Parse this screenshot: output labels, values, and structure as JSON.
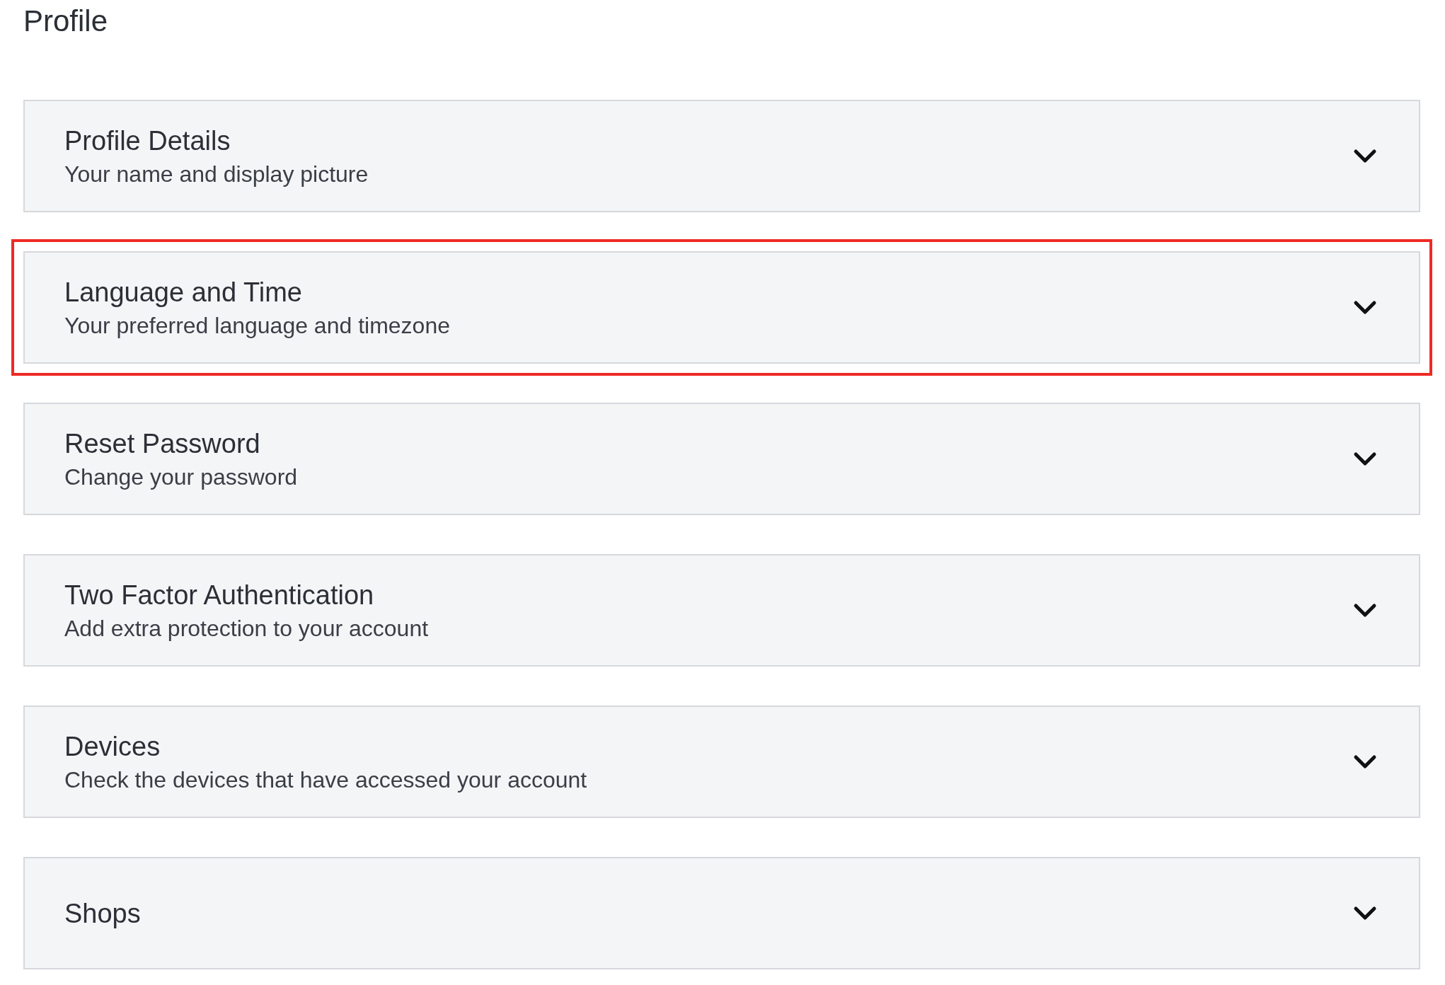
{
  "page": {
    "title": "Profile"
  },
  "sections": [
    {
      "title": "Profile Details",
      "subtitle": "Your name and display picture",
      "expanded": false,
      "highlighted": false
    },
    {
      "title": "Language and Time",
      "subtitle": "Your preferred language and timezone",
      "expanded": false,
      "highlighted": true
    },
    {
      "title": "Reset Password",
      "subtitle": "Change your password",
      "expanded": false,
      "highlighted": false
    },
    {
      "title": "Two Factor Authentication",
      "subtitle": "Add extra protection to your account",
      "expanded": false,
      "highlighted": false
    },
    {
      "title": "Devices",
      "subtitle": "Check the devices that have accessed your account",
      "expanded": false,
      "highlighted": false
    },
    {
      "title": "Shops",
      "expanded": false,
      "highlighted": false
    }
  ]
}
